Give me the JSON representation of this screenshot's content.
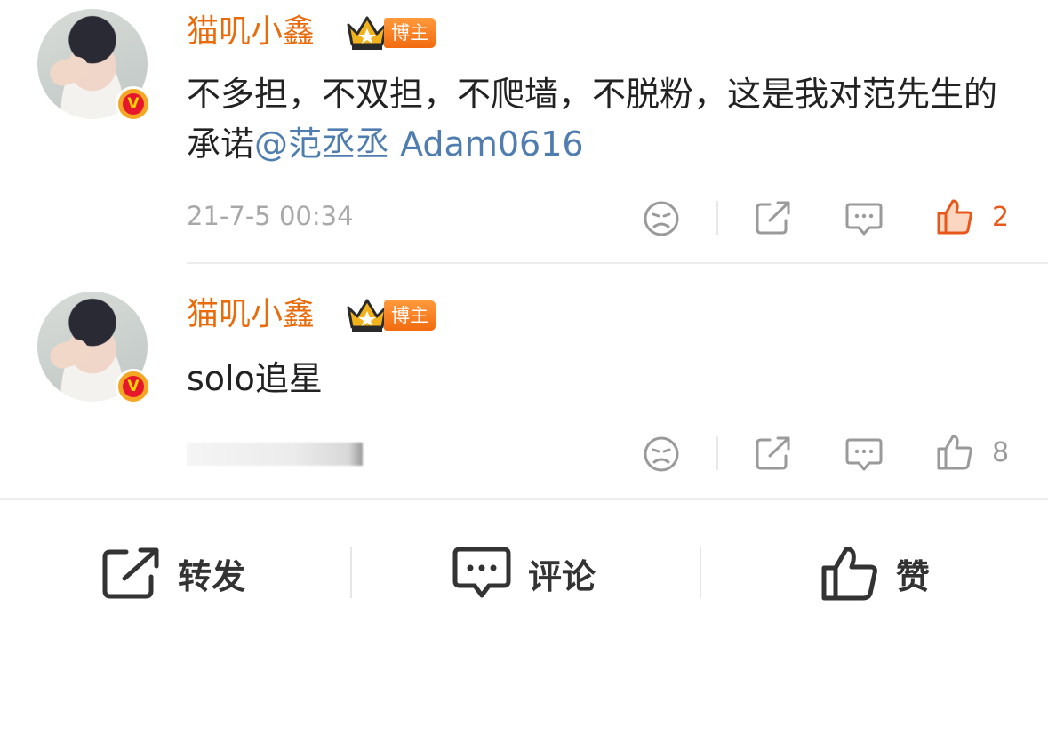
{
  "comments": [
    {
      "username": "猫叽小鑫",
      "tag": "博主",
      "text": "不多担，不双担，不爬墙，不脱粉，这是我对范先生的承诺",
      "mention": "@范丞丞 Adam0616",
      "timestamp": "21-7-5 00:34",
      "likes": "2",
      "liked": true
    },
    {
      "username": "猫叽小鑫",
      "tag": "博主",
      "text": "solo追星",
      "mention": "",
      "timestamp": "",
      "likes": "8",
      "liked": false
    }
  ],
  "bottom_bar": {
    "repost_label": "转发",
    "comment_label": "评论",
    "like_label": "赞"
  },
  "colors": {
    "username": "#e86b0c",
    "mention": "#507daf",
    "liked": "#e9581b",
    "icon_gray": "#9a9a9a"
  },
  "icons": [
    "verified-v-icon",
    "crown-icon",
    "dislike-face-icon",
    "repost-icon",
    "comment-icon",
    "thumbs-up-icon"
  ]
}
